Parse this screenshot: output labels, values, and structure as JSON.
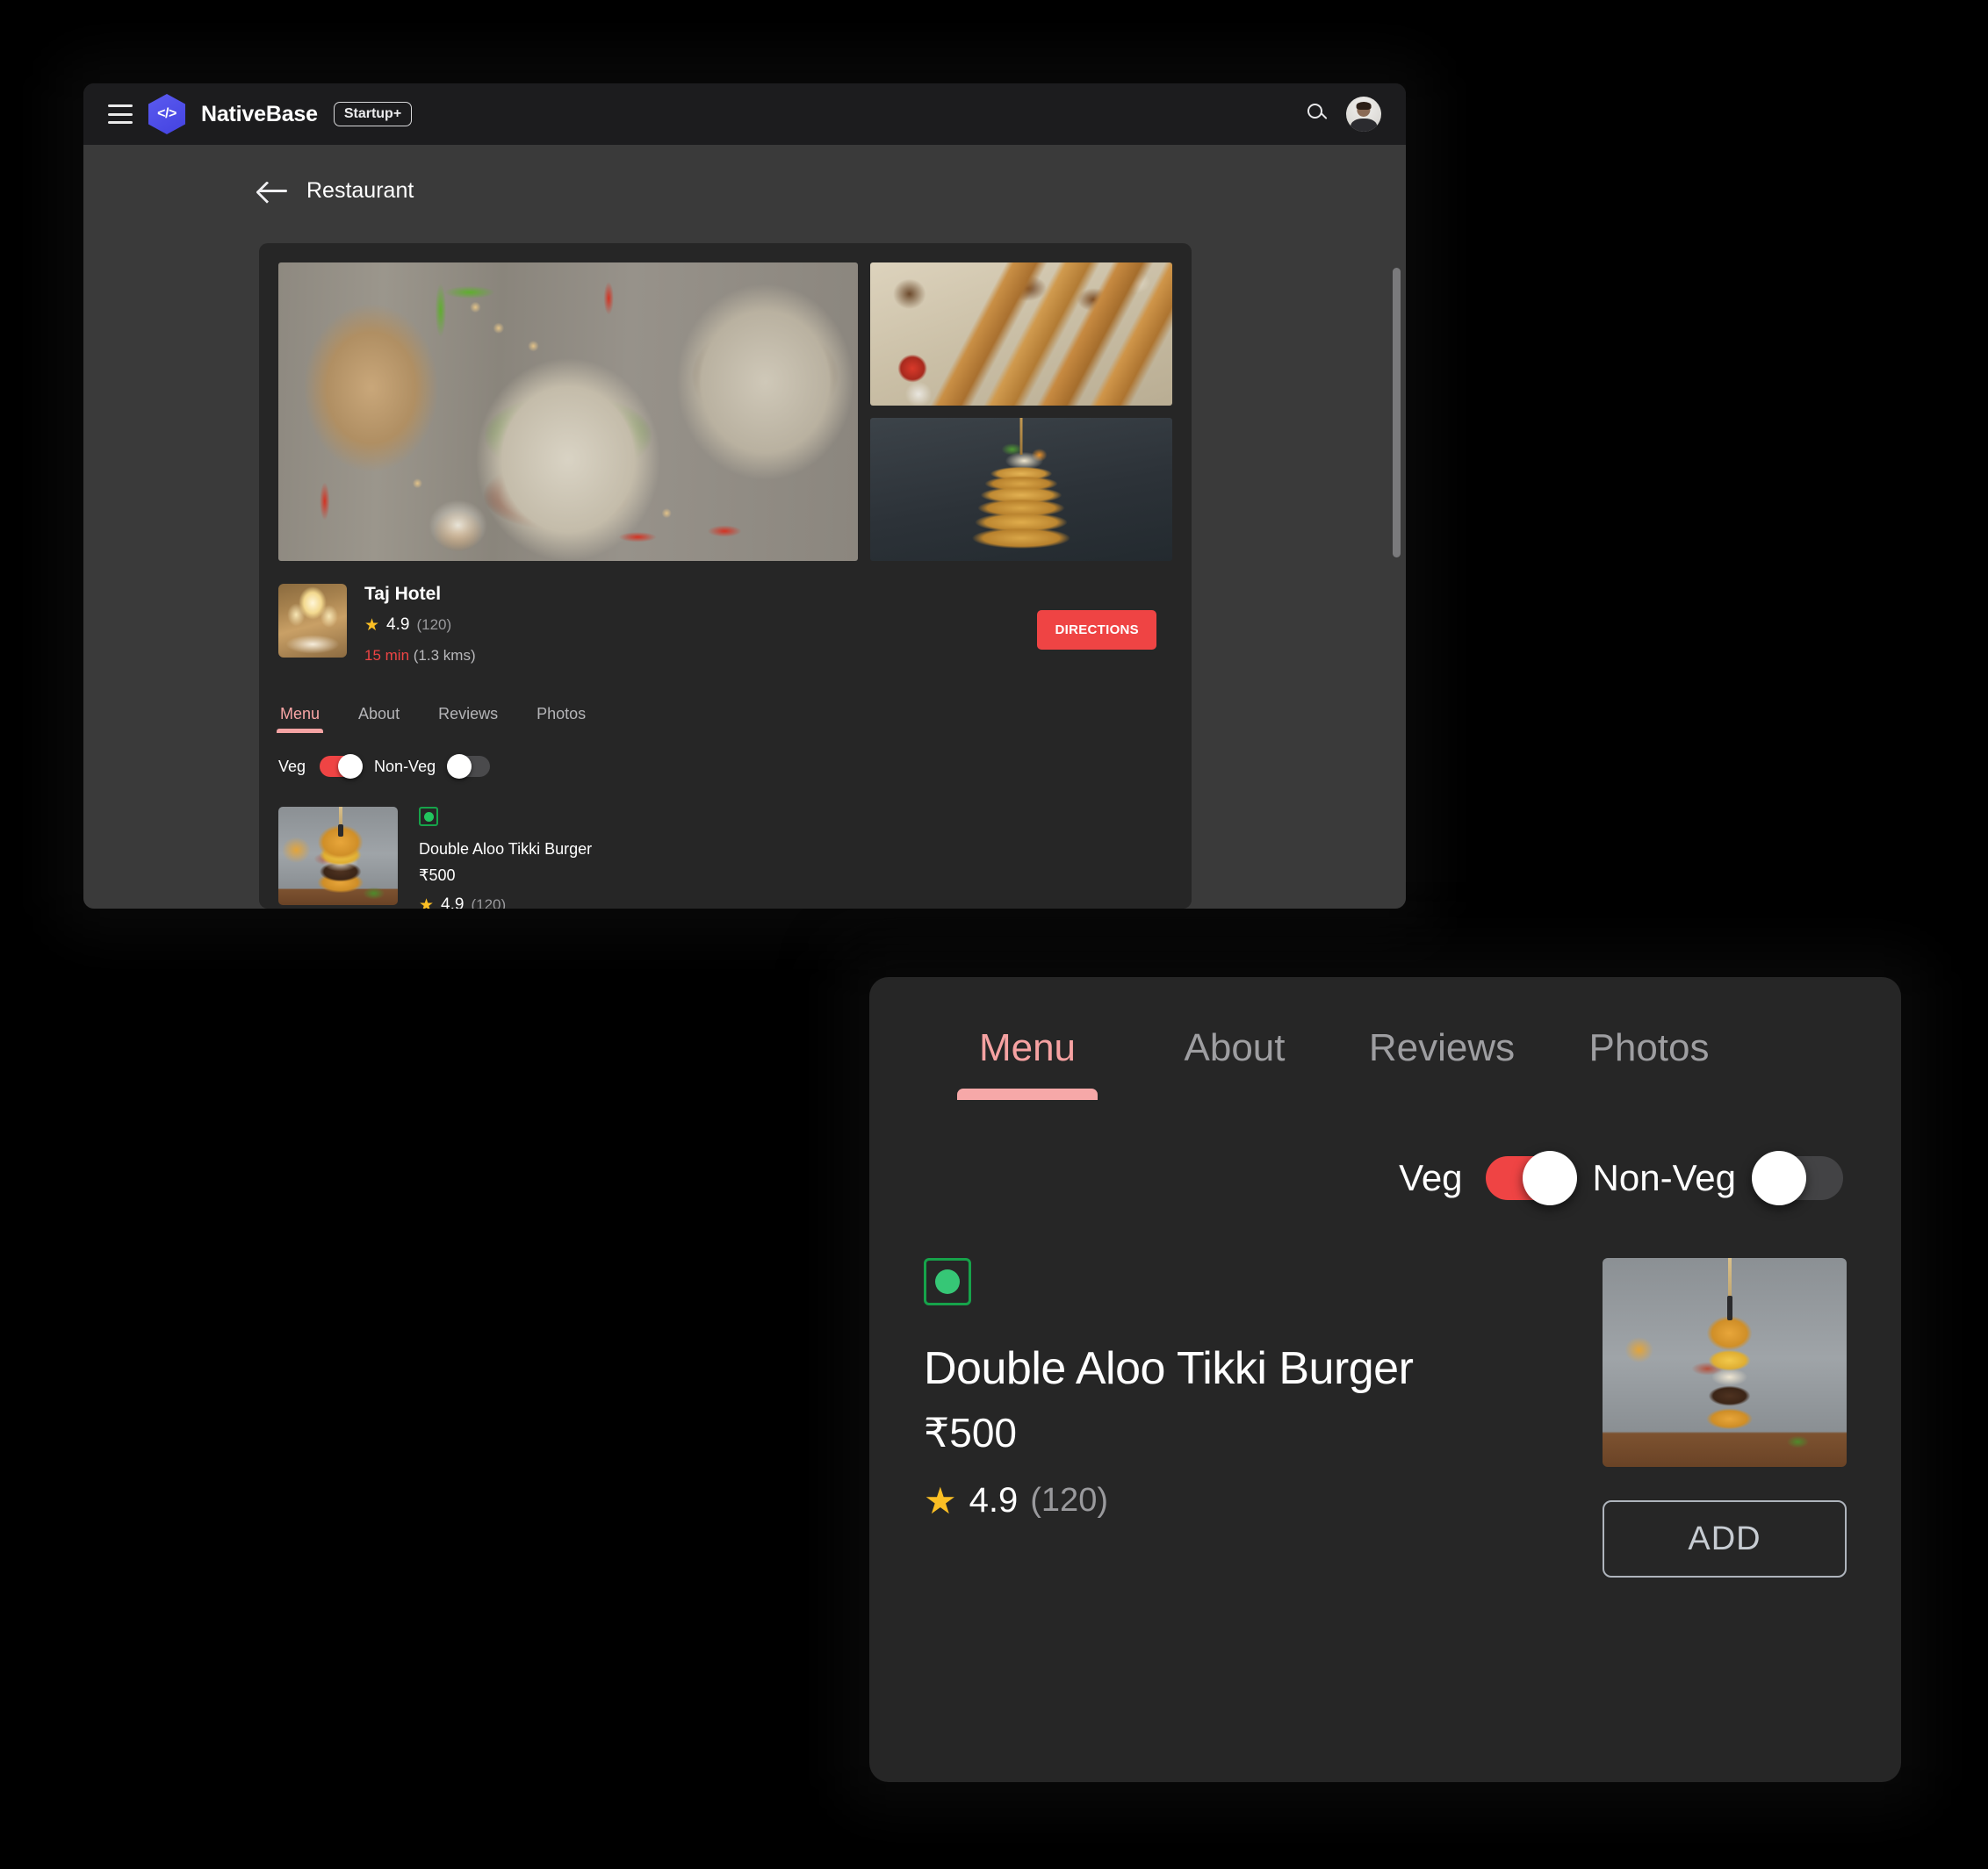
{
  "app": {
    "brand": "NativeBase",
    "badge": "Startup+",
    "menu_icon": "hamburger-icon",
    "logo_icon": "code-hex-logo-icon",
    "search_icon": "search-icon",
    "avatar_icon": "user-avatar"
  },
  "breadcrumb": {
    "back_icon": "back-arrow-icon",
    "title": "Restaurant"
  },
  "gallery": {
    "images": [
      {
        "name": "plates-of-food",
        "alt": "Assorted meat plates with herbs and chillies"
      },
      {
        "name": "grilled-chicken",
        "alt": "Grilled chicken strips with ketchup dip"
      },
      {
        "name": "pancake-stack",
        "alt": "Stack of pancakes with syrup"
      }
    ]
  },
  "restaurant": {
    "thumb": "banquet-hall-photo",
    "name": "Taj Hotel",
    "star_icon": "star-icon",
    "rating": "4.9",
    "rating_count": "(120)",
    "eta": "15 min",
    "distance": "(1.3 kms)",
    "directions_label": "DIRECTIONS"
  },
  "tabs": [
    {
      "label": "Menu",
      "active": true
    },
    {
      "label": "About",
      "active": false
    },
    {
      "label": "Reviews",
      "active": false
    },
    {
      "label": "Photos",
      "active": false
    }
  ],
  "filters": {
    "veg": {
      "label": "Veg",
      "state": "on"
    },
    "nonveg": {
      "label": "Non-Veg",
      "state": "off"
    }
  },
  "menu_item": {
    "veg_mark": "veg-indicator-icon",
    "name": "Double Aloo Tikki Burger",
    "price": "₹500",
    "star_icon": "star-icon",
    "rating": "4.9",
    "rating_count": "(120)",
    "image": "burger-photo",
    "add_label": "ADD"
  },
  "colors": {
    "accent_red": "#EF4444",
    "tab_active": "#F6A2A2",
    "brand_purple": "#4E4EE6",
    "veg_green": "#16A34A",
    "star_yellow": "#FBBF24",
    "window_bg": "#262626",
    "viewport_bg": "#3A3A3A",
    "topbar_bg": "#1C1C1E"
  },
  "scrollbar": {
    "name": "vertical-scrollbar"
  }
}
